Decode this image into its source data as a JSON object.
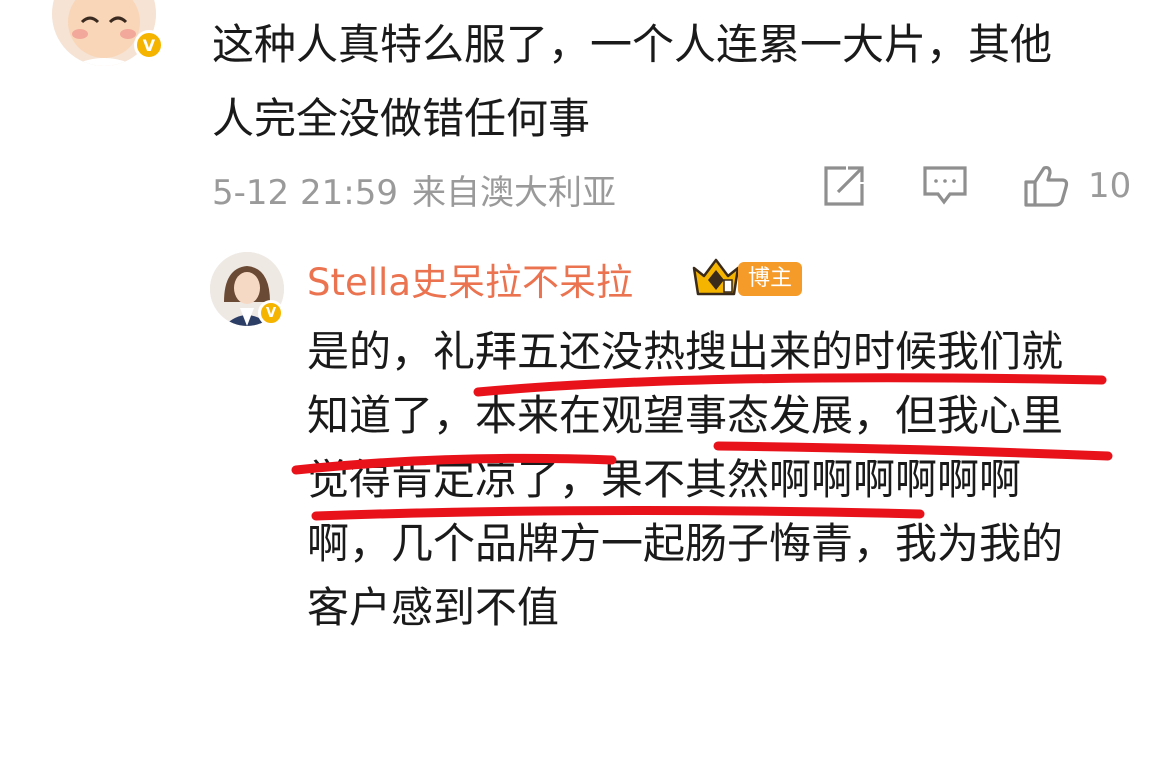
{
  "comment": {
    "text": "这种人真特么服了，一个人连累一大片，其他人完全没做错任何事",
    "time": "5-12 21:59",
    "source": "来自澳大利亚",
    "like_count": "10",
    "icons": [
      "share-icon",
      "comment-icon",
      "like-icon"
    ]
  },
  "reply": {
    "author": "Stella史呆拉不呆拉",
    "role_badge": "博主",
    "text": "是的，礼拜五还没热搜出来的时候我们就知道了，本来在观望事态发展，但我心里觉得肯定凉了，果不其然啊啊啊啊啊啊啊，几个品牌方一起肠子悔青，我为我的客户感到不值"
  },
  "colors": {
    "author_orange": "#eb7350",
    "verify_gold": "#f5b400",
    "meta_gray": "#9a9a9a",
    "annotation_red": "#e8121b",
    "badge_orange": "#f59b2a"
  }
}
